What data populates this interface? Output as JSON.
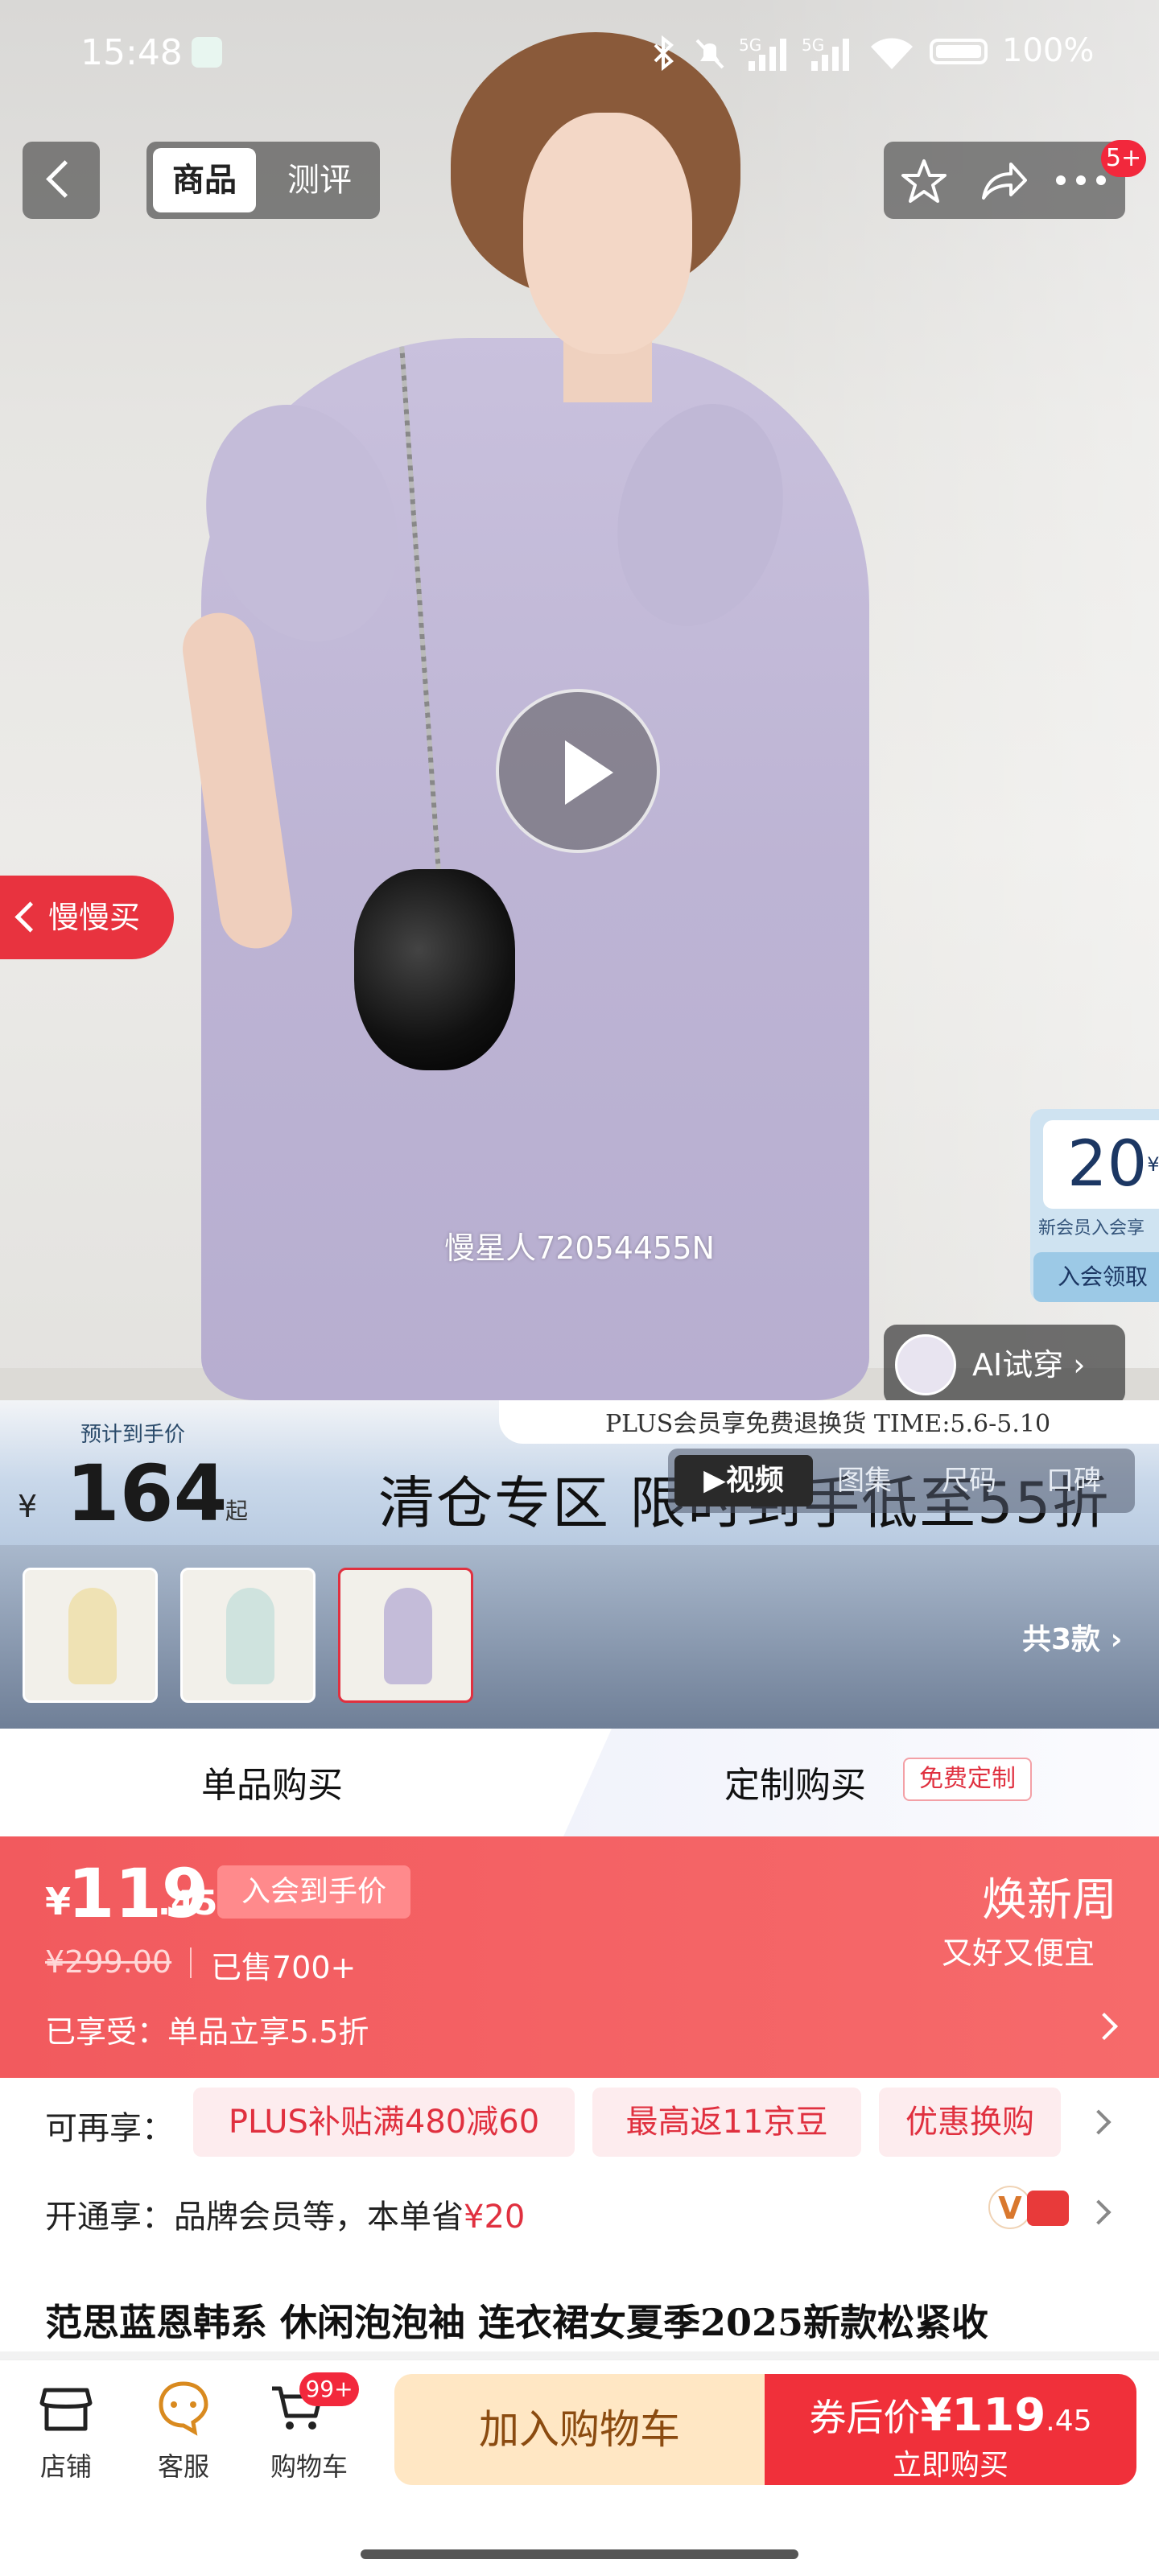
{
  "status_bar": {
    "time": "15:48",
    "signal1": "5G",
    "signal2": "5G",
    "battery": "100%"
  },
  "top_nav": {
    "tab_goods": "商品",
    "tab_review": "测评",
    "badge": "5+"
  },
  "hero": {
    "slow_buy": "慢慢买",
    "watermark": "慢星人72054455N",
    "ai_tryon": "AI试穿 ›"
  },
  "coupon": {
    "amount": "20",
    "currency": "¥",
    "sub": "新会员入会享",
    "button": "入会领取"
  },
  "banner": {
    "plus_text": "PLUS会员享免费退换货   TIME:5.6-5.10",
    "est_label": "预计到手价",
    "yen": "¥",
    "price": "164",
    "qi": "起",
    "clearance": "清仓专区  限时到手低至55折",
    "media_tabs": [
      "▶视频",
      "图集",
      "尺码",
      "口碑"
    ]
  },
  "thumbs": {
    "total": "共3款 ›"
  },
  "buy_tabs": {
    "single": "单品购买",
    "custom": "定制购买",
    "free_custom": "免费定制"
  },
  "price_block": {
    "yen": "¥",
    "price_int": "119",
    "price_dec": ".45",
    "member_tag": "入会到手价",
    "orig_price": "¥299.00",
    "sold": "已售700+",
    "enjoyed": "已享受：单品立享5.5折",
    "promo_title": "焕新周",
    "promo_sub": "又好又便宜"
  },
  "promo": {
    "label": "可再享：",
    "chips": [
      "PLUS补贴满480减60",
      "最高返11京豆",
      "优惠换购"
    ],
    "open_label": "开通享：品牌会员等，本单省",
    "open_saving": "¥20"
  },
  "product_title": "范思蓝恩韩系 休闲泡泡袖 连衣裙女夏季2025新款松紧收",
  "bottom_bar": {
    "store": "店铺",
    "service": "客服",
    "cart": "购物车",
    "cart_badge": "99+",
    "add_cart": "加入购物车",
    "after_coupon_label": "券后价",
    "after_coupon_price": "¥119",
    "after_coupon_dec": ".45",
    "buy_now": "立即购买"
  },
  "colors": {
    "accent_red": "#f0303a",
    "price_block": "#f25a5e",
    "cart_bg": "#ffe7c4"
  }
}
